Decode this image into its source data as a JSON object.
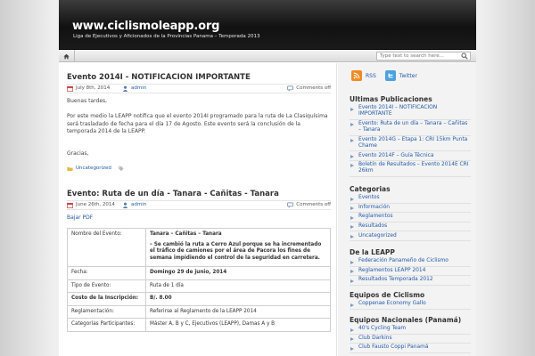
{
  "header": {
    "title": "www.ciclismoleapp.org",
    "description": "Liga de Ejecutivos y Aficionados de la Provincias Panama – Temporada 2013"
  },
  "nav": {
    "home_icon": "home-icon",
    "search_placeholder": "Type text to search here..."
  },
  "posts": [
    {
      "title": "Evento 2014I - NOTIFICACION IMPORTANTE",
      "date": "July 8th, 2014",
      "author": "admin",
      "comments": "Comments off",
      "paragraphs": [
        "Buenas tardes,",
        "Por este medio la LEAPP notifica que el evento 2014I programado para la ruta de La Clasiquísima será trasladado de fecha para el día 17 de Agosto. Este evento será la conclusión de la temporada 2014 de la LEAPP.",
        "Gracias,"
      ],
      "category": "Uncategorized"
    },
    {
      "title": "Evento: Ruta de un día - Tanara - Cañitas - Tanara",
      "date": "June 26th, 2014",
      "author": "admin",
      "comments": "Comments off",
      "download": "Bajar PDF",
      "table": {
        "name_label": "Nombre del Evento:",
        "name_value": "Tanara – Cañitas – Tanara",
        "name_note": " – Se cambió la ruta a Cerro Azul porque se ha incrementado el tráfico de camiones por el área de Pacora los fines de semana impidiendo el control de la seguridad en carretera.",
        "date_label": "Fecha:",
        "date_value": "Domingo 29 de junio, 2014",
        "type_label": "Tipo de Evento:",
        "type_value": "Ruta de 1 día",
        "cost_label": "Costo de la Inscripción:",
        "cost_value": "B/. 8.00",
        "rules_label": "Reglamentación:",
        "rules_value": "Referirse al Reglamento de la LEAPP 2014",
        "cat_label": "Categorías Participantes:",
        "cat_value": "Máster A, B y C, Ejecutivos (LEAPP), Damas A y B"
      }
    }
  ],
  "sidebar": {
    "rss_label": "RSS",
    "twitter_label": "Twitter",
    "widgets": [
      {
        "title": "Ultimas Publicaciones",
        "items": [
          "Evento 2014I – NOTIFICACION IMPORTANTE",
          "Evento: Ruta de un día – Tanara – Cañitas – Tanara",
          "Evento 2014G – Etapa 1: CRI 15km Punta Chame",
          "Evento 2014F – Guía Técnica",
          "Boletín de Resultados – Evento 2014E CRI 26km"
        ]
      },
      {
        "title": "Categorias",
        "items": [
          "Eventos",
          "Información",
          "Reglamentos",
          "Resultados",
          "Uncategorized"
        ]
      },
      {
        "title": "De la LEAPP",
        "items": [
          "Federación Panameño de Ciclismo",
          "Reglamentos LEAPP 2014",
          "Resultados Temporada 2012"
        ]
      },
      {
        "title": "Equipos de Ciclismo",
        "items": [
          "Coppenae Economy Gallo"
        ]
      },
      {
        "title": "Equipos Nacionales (Panamá)",
        "items": [
          "40's Cycling Team",
          "Club Darkins",
          "Club Fausto Coppi Panamá"
        ]
      }
    ]
  },
  "colors": {
    "link": "#2259a8",
    "header_bg": "#111111"
  }
}
